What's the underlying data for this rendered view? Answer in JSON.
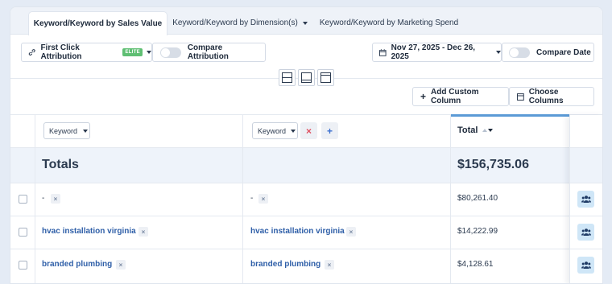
{
  "tabs": [
    {
      "label": "Keyword/Keyword by Sales Value",
      "active": true
    },
    {
      "label": "Keyword/Keyword by Dimension(s)",
      "active": false,
      "has_dropdown": true
    },
    {
      "label": "Keyword/Keyword by Marketing Spend",
      "active": false
    }
  ],
  "toolbar": {
    "attribution_label": "First Click Attribution",
    "attribution_badge": "ELITE",
    "compare_attribution_label": "Compare Attribution",
    "date_range": "Nov 27, 2025 - Dec 26, 2025",
    "compare_date_label": "Compare Date",
    "add_custom_column": "Add Custom Column",
    "choose_columns": "Choose Columns"
  },
  "table": {
    "col1_select": "Keyword",
    "col2_select": "Keyword",
    "total_header": "Total",
    "totals_label": "Totals",
    "totals_value": "$156,735.06",
    "rows": [
      {
        "col1": "-",
        "col2": "-",
        "total": "$80,261.40"
      },
      {
        "col1": "hvac installation virginia",
        "col2": "hvac installation virginia",
        "total": "$14,222.99"
      },
      {
        "col1": "branded plumbing",
        "col2": "branded plumbing",
        "total": "$4,128.61"
      }
    ]
  },
  "colors": {
    "accent_blue": "#2f5fa8",
    "elite_green": "#5fbf73",
    "total_header_bar": "#5b9ad6",
    "remove_red": "#e05060",
    "add_blue": "#3b6fd0"
  }
}
